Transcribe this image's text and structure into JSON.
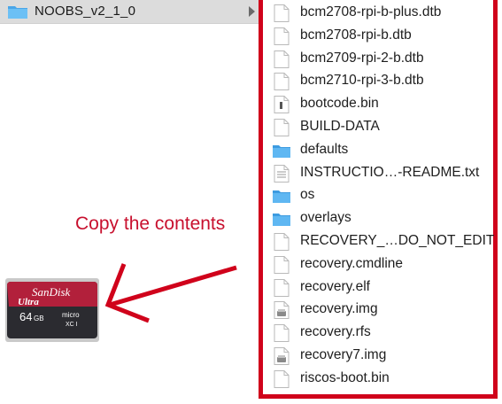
{
  "sidebar": {
    "folder_label": "NOOBS_v2_1_0"
  },
  "files": [
    {
      "name": "bcm2708-rpi-b-plus.dtb",
      "icon": "file-icon"
    },
    {
      "name": "bcm2708-rpi-b.dtb",
      "icon": "file-icon"
    },
    {
      "name": "bcm2709-rpi-2-b.dtb",
      "icon": "file-icon"
    },
    {
      "name": "bcm2710-rpi-3-b.dtb",
      "icon": "file-icon"
    },
    {
      "name": "bootcode.bin",
      "icon": "binary-file-icon"
    },
    {
      "name": "BUILD-DATA",
      "icon": "file-icon"
    },
    {
      "name": "defaults",
      "icon": "folder-icon"
    },
    {
      "name": "INSTRUCTIO…-README.txt",
      "icon": "text-file-icon"
    },
    {
      "name": "os",
      "icon": "folder-icon"
    },
    {
      "name": "overlays",
      "icon": "folder-icon"
    },
    {
      "name": "RECOVERY_…DO_NOT_EDIT",
      "icon": "file-icon"
    },
    {
      "name": "recovery.cmdline",
      "icon": "file-icon"
    },
    {
      "name": "recovery.elf",
      "icon": "file-icon"
    },
    {
      "name": "recovery.img",
      "icon": "disk-image-icon"
    },
    {
      "name": "recovery.rfs",
      "icon": "file-icon"
    },
    {
      "name": "recovery7.img",
      "icon": "disk-image-icon"
    },
    {
      "name": "riscos-boot.bin",
      "icon": "file-icon"
    }
  ],
  "annotation": {
    "caption": "Copy the contents"
  },
  "sdcard": {
    "brand": "SanDisk",
    "line": "Ultra",
    "capacity": "64",
    "unit": "GB",
    "logo": "micro",
    "class": "XC I"
  },
  "colors": {
    "highlight": "#d0021b",
    "folder": "#4aa6e8"
  }
}
